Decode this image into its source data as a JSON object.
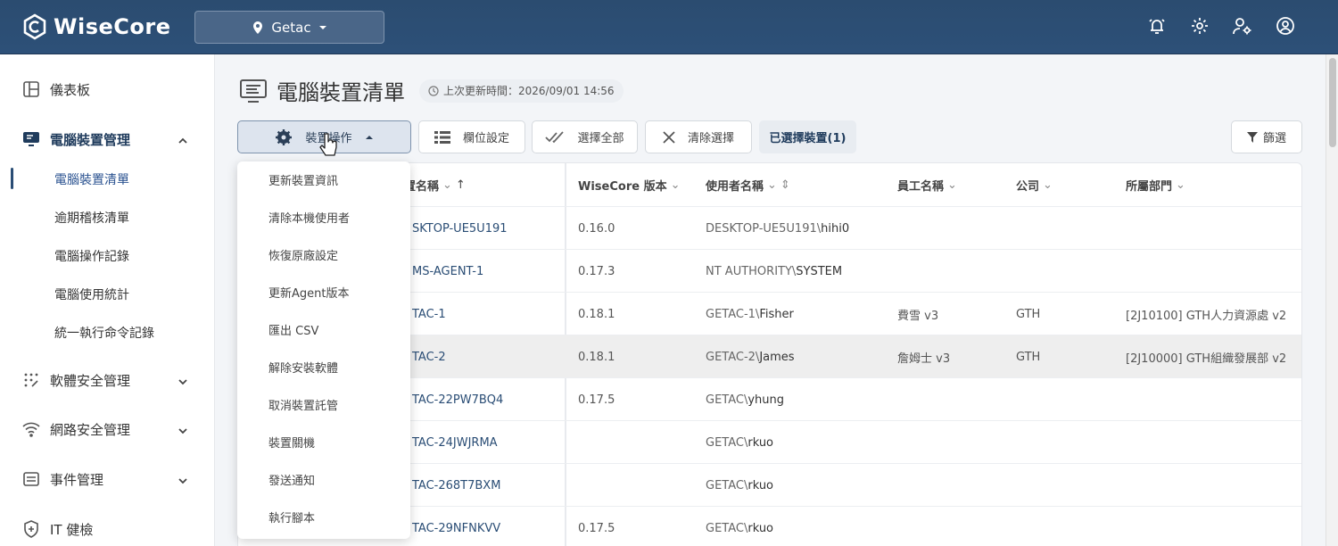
{
  "app": {
    "name": "WiseCore"
  },
  "site_selector": {
    "value": "Getac"
  },
  "sidebar": {
    "dashboard": "儀表板",
    "device_mgmt": "電腦裝置管理",
    "sub": [
      "電腦裝置清單",
      "逾期稽核清單",
      "電腦操作記錄",
      "電腦使用統計",
      "統一執行命令記錄"
    ],
    "software_security": "軟體安全管理",
    "network_security": "網路安全管理",
    "event_mgmt": "事件管理",
    "it_health": "IT 健檢"
  },
  "page": {
    "title": "電腦裝置清單",
    "last_updated": "上次更新時間：2026/09/01 14:56"
  },
  "toolbar": {
    "device_ops": "裝置操作",
    "column_settings": "欄位設定",
    "select_all": "選擇全部",
    "clear_selection": "清除選擇",
    "selected_devices": "已選擇裝置(1)",
    "filter": "篩選"
  },
  "table": {
    "headers": {
      "device_name": "置名稱",
      "version": "WiseCore 版本",
      "user_name": "使用者名稱",
      "employee": "員工名稱",
      "company": "公司",
      "department": "所屬部門"
    },
    "rows": [
      {
        "name": "SKTOP-UE5U191",
        "version": "0.16.0",
        "user_prefix": "DESKTOP-UE5U191\\",
        "user": "hihi0",
        "employee": "",
        "company": "",
        "dept": ""
      },
      {
        "name": "MS-AGENT-1",
        "version": "0.17.3",
        "user_prefix": "NT AUTHORITY\\",
        "user": "SYSTEM",
        "employee": "",
        "company": "",
        "dept": ""
      },
      {
        "name": "TAC-1",
        "version": "0.18.1",
        "user_prefix": "GETAC-1\\",
        "user": "Fisher",
        "employee": "費雪 v3",
        "company": "GTH",
        "dept": "[2J10100] GTH人力資源處 v2"
      },
      {
        "name": "TAC-2",
        "version": "0.18.1",
        "user_prefix": "GETAC-2\\",
        "user": "James",
        "employee": "詹姆士 v3",
        "company": "GTH",
        "dept": "[2J10000] GTH組織發展部 v2"
      },
      {
        "name": "TAC-22PW7BQ4",
        "version": "0.17.5",
        "user_prefix": "GETAC\\",
        "user": "yhung",
        "employee": "",
        "company": "",
        "dept": ""
      },
      {
        "name": "TAC-24JWJRMA",
        "version": "",
        "user_prefix": "GETAC\\",
        "user": "rkuo",
        "employee": "",
        "company": "",
        "dept": ""
      },
      {
        "name": "TAC-268T7BXM",
        "version": "",
        "user_prefix": "GETAC\\",
        "user": "rkuo",
        "employee": "",
        "company": "",
        "dept": ""
      },
      {
        "name": "TAC-29NFNKVV",
        "version": "0.17.5",
        "user_prefix": "GETAC\\",
        "user": "rkuo",
        "employee": "",
        "company": "",
        "dept": ""
      }
    ]
  },
  "dropdown_menu": [
    "更新裝置資訊",
    "清除本機使用者",
    "恢復原廠設定",
    "更新Agent版本",
    "匯出 CSV",
    "解除安裝軟體",
    "取消裝置託管",
    "裝置關機",
    "發送通知",
    "執行腳本"
  ]
}
